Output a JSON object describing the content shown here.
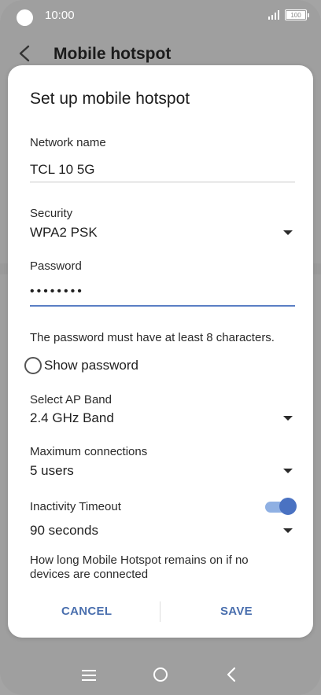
{
  "status": {
    "time": "10:00",
    "battery": "100"
  },
  "appbar": {
    "title": "Mobile hotspot"
  },
  "dialog": {
    "title": "Set up mobile hotspot",
    "network_name": {
      "label": "Network name",
      "value": "TCL 10 5G"
    },
    "security": {
      "label": "Security",
      "value": "WPA2 PSK"
    },
    "password": {
      "label": "Password",
      "value": "••••••••"
    },
    "password_help": "The password must have at least 8 characters.",
    "show_password": {
      "label": "Show password",
      "checked": false
    },
    "ap_band": {
      "label": "Select AP Band",
      "value": "2.4 GHz Band"
    },
    "max_connections": {
      "label": "Maximum connections",
      "value": "5 users"
    },
    "inactivity_timeout": {
      "label": "Inactivity Timeout",
      "enabled": true,
      "value": "90 seconds"
    },
    "timeout_help_line1": "How long Mobile Hotspot remains on if no",
    "timeout_help_line2": "devices are connected",
    "cancel_label": "CANCEL",
    "save_label": "SAVE"
  },
  "colors": {
    "accent": "#4a72c2",
    "button_text": "#4a6fae",
    "scrim": "#9f9f9f"
  },
  "icons": [
    "back-arrow-icon",
    "signal-icon",
    "battery-icon",
    "dropdown-arrow-icon",
    "menu-icon",
    "home-icon",
    "nav-back-icon"
  ]
}
